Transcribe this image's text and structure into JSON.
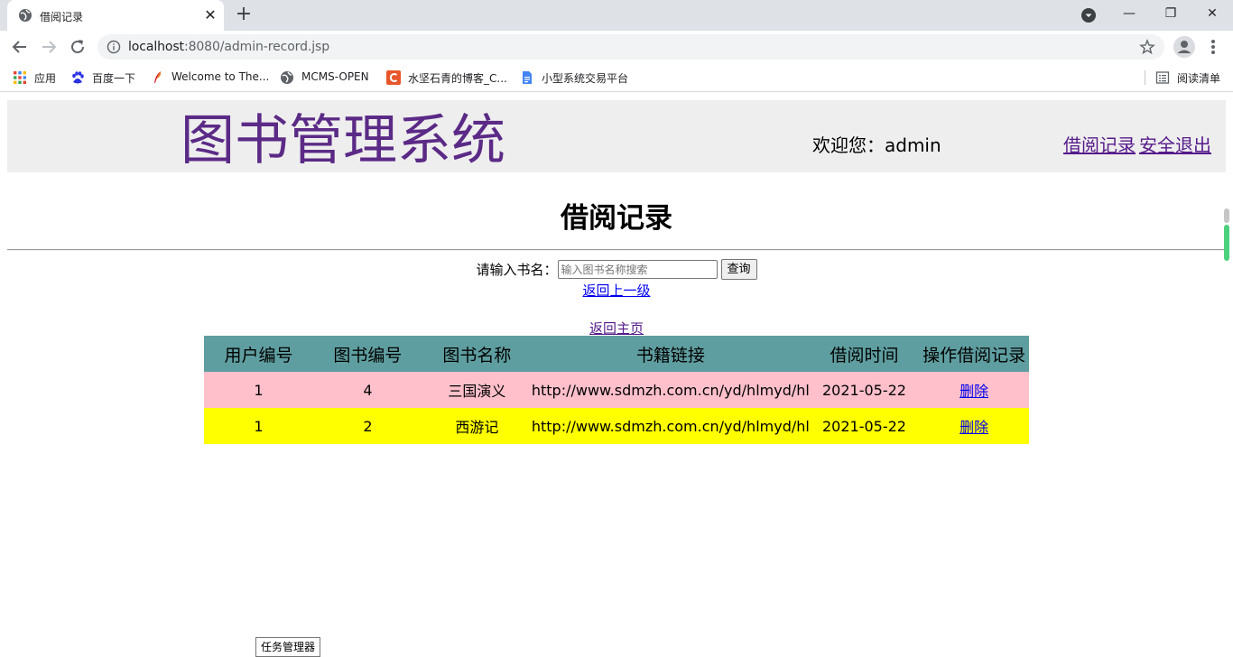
{
  "browser": {
    "tab_title": "借阅记录",
    "tab_close": "✕",
    "new_tab": "+",
    "url_host": "localhost",
    "url_rest": ":8080/admin-record.jsp",
    "window_controls": {
      "minimize": "—",
      "maximize": "❐",
      "close": "✕"
    }
  },
  "bookmarks": {
    "items": [
      {
        "label": "应用",
        "icon": "apps-grid-icon"
      },
      {
        "label": "百度一下",
        "icon": "baidu-paw-icon"
      },
      {
        "label": "Welcome to The...",
        "icon": "feather-icon"
      },
      {
        "label": "MCMS-OPEN",
        "icon": "globe-icon"
      },
      {
        "label": "水坚石青的博客_C...",
        "icon": "csdn-c-icon"
      },
      {
        "label": "小型系统交易平台",
        "icon": "doc-icon"
      }
    ],
    "reading_list": "阅读清单"
  },
  "header": {
    "site_title": "图书管理系统",
    "welcome": "欢迎您：admin",
    "link_records": "借阅记录",
    "link_logout": "安全退出"
  },
  "main": {
    "page_title": "借阅记录",
    "search_label": "请输入书名：",
    "search_placeholder": "输入图书名称搜索",
    "search_button": "查询",
    "back_up": "返回上一级",
    "back_home": "返回主页"
  },
  "table": {
    "columns": [
      "用户编号",
      "图书编号",
      "图书名称",
      "书籍链接",
      "借阅时间",
      "操作借阅记录"
    ],
    "rows": [
      {
        "user_id": "1",
        "book_id": "4",
        "book_name": "三国演义",
        "link": "http://www.sdmzh.com.cn/yd/hlmyd/hl",
        "time": "2021-05-22",
        "action": "删除"
      },
      {
        "user_id": "1",
        "book_id": "2",
        "book_name": "西游记",
        "link": "http://www.sdmzh.com.cn/yd/hlmyd/hl",
        "time": "2021-05-22",
        "action": "删除"
      }
    ]
  },
  "tooltip": {
    "task_manager": "任务管理器"
  },
  "colors": {
    "header_bg": "#eeeeee",
    "title_purple": "#5b2a86",
    "table_head": "#5f9ea0",
    "row_pink": "#ffc0cb",
    "row_yellow": "#ffff00"
  }
}
